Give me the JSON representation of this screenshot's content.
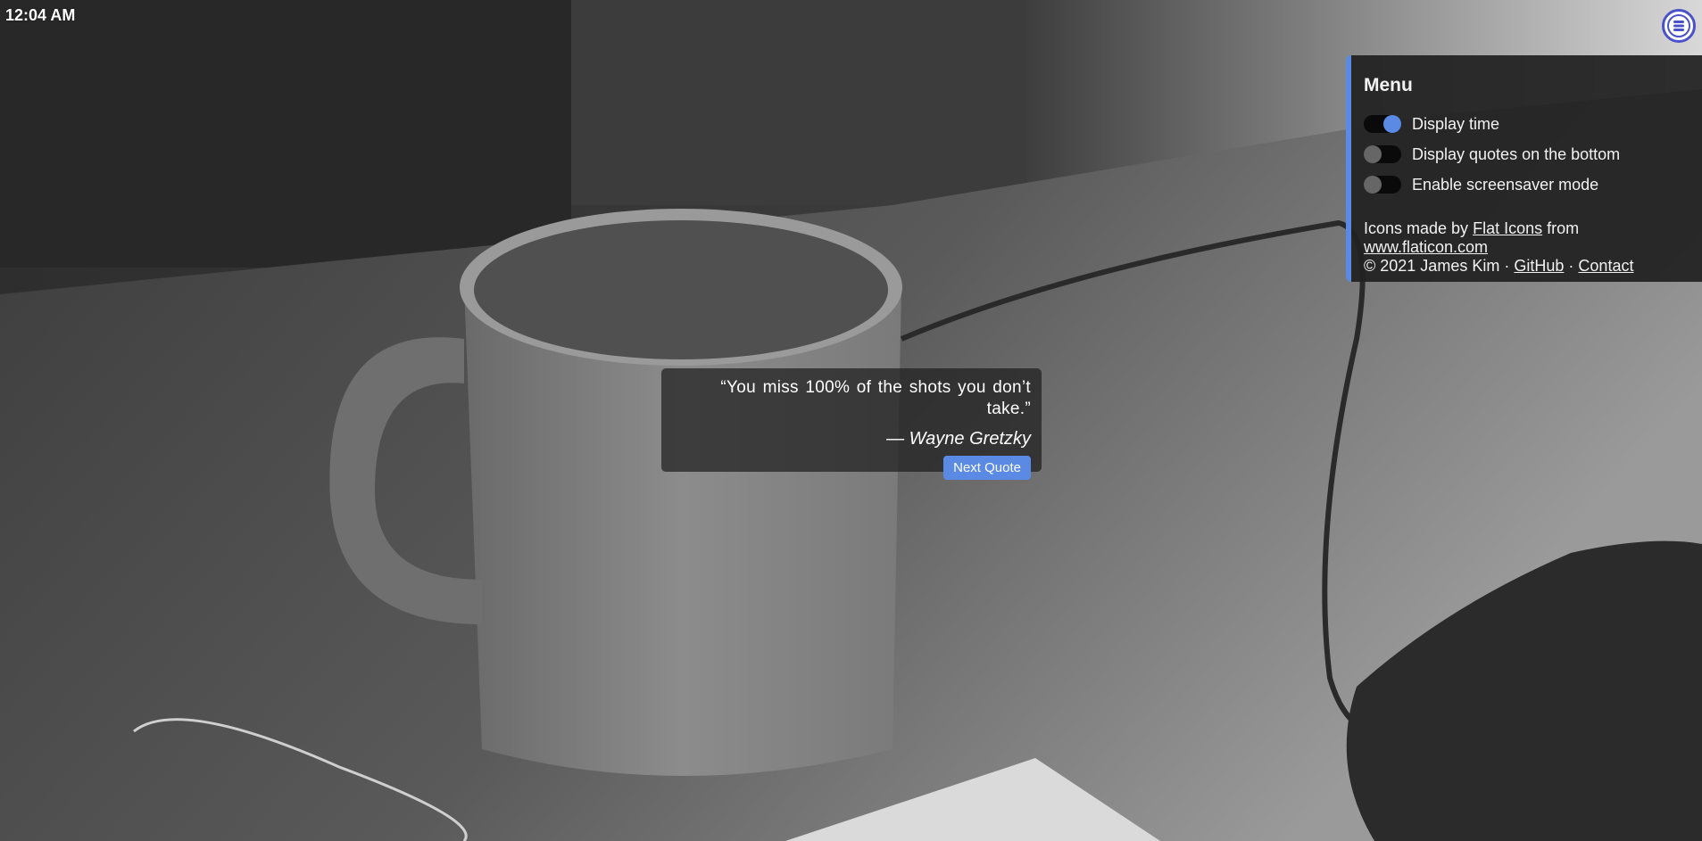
{
  "clock": {
    "time": "12:04 AM"
  },
  "menu": {
    "title": "Menu",
    "toggles": [
      {
        "label": "Display time",
        "on": true
      },
      {
        "label": "Display quotes on the bottom",
        "on": false
      },
      {
        "label": "Enable screensaver mode",
        "on": false
      }
    ],
    "credits": {
      "icons_prefix": "Icons made by",
      "icons_author": "Flat Icons",
      "from": "from",
      "icons_site": "www.flaticon.com",
      "copyright": "© 2021 James Kim",
      "separator": "·",
      "github": "GitHub",
      "contact": "Contact"
    }
  },
  "quote": {
    "text": "“You miss 100% of the shots you don’t take.”",
    "dash": "—",
    "author": "Wayne Gretzky",
    "next_label": "Next Quote"
  },
  "colors": {
    "accent": "#5b8ae5",
    "menu_icon_ring": "#4b52c9",
    "panel_bg": "#222222"
  },
  "icons": {
    "menu": "menu-lines-icon"
  }
}
